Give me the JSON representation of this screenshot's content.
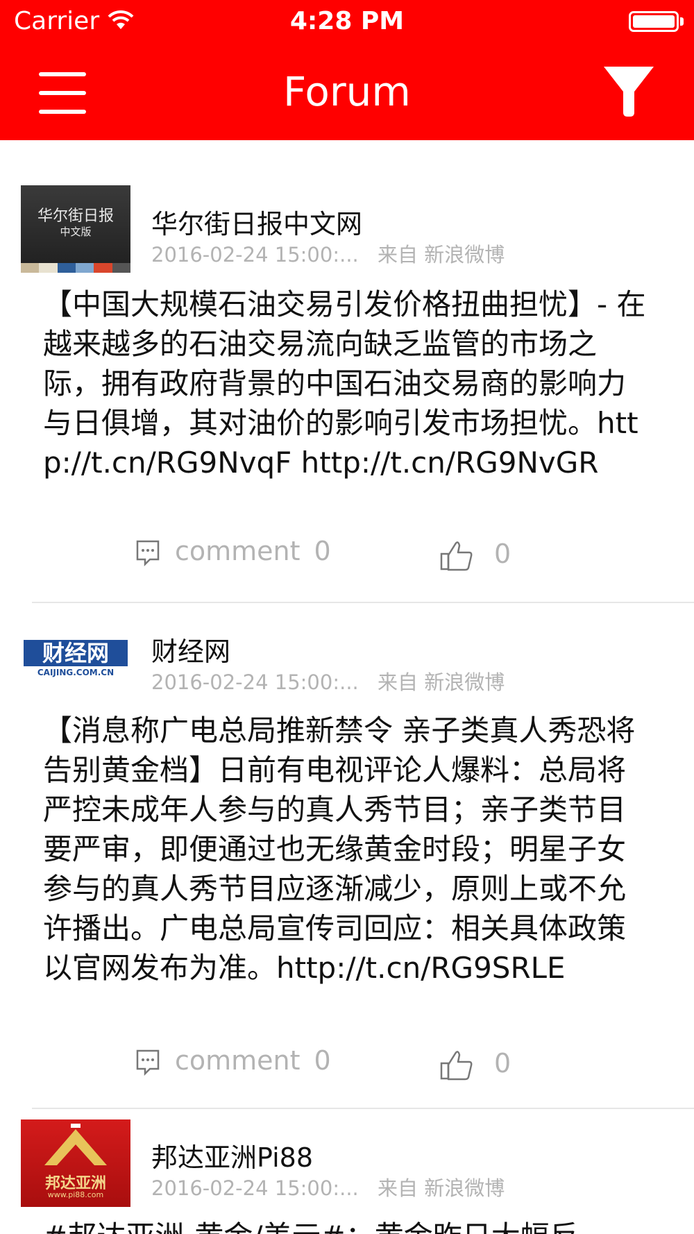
{
  "colors": {
    "brand": "#ff0000",
    "meta_text": "#b3b3b3"
  },
  "status_bar": {
    "carrier": "Carrier",
    "time": "4:28 PM"
  },
  "nav": {
    "title": "Forum",
    "menu_icon": "hamburger-menu-icon",
    "filter_icon": "filter-funnel-icon"
  },
  "posts": [
    {
      "avatar_text": "华尔街日报",
      "avatar_subtext": "中文版",
      "author": "华尔街日报中文网",
      "timestamp": "2016-02-24 15:00:...",
      "source": "来自 新浪微博",
      "body": "【中国大规模石油交易引发价格扭曲担忧】- 在越来越多的石油交易流向缺乏监管的市场之际，拥有政府背景的中国石油交易商的影响力与日俱增，其对油价的影响引发市场担忧。http://t.cn/RG9NvqF http://t.cn/RG9NvGR",
      "comment_label": "comment",
      "comment_count": "0",
      "like_count": "0"
    },
    {
      "avatar_text": "财经网",
      "avatar_subtext": "CAIJING.COM.CN",
      "author": "财经网",
      "timestamp": "2016-02-24 15:00:...",
      "source": "来自 新浪微博",
      "body": "【消息称广电总局推新禁令 亲子类真人秀恐将告别黄金档】日前有电视评论人爆料：总局将严控未成年人参与的真人秀节目；亲子类节目要严审，即便通过也无缘黄金时段；明星子女参与的真人秀节目应逐渐减少，原则上或不允许播出。广电总局宣传司回应：相关具体政策以官网发布为准。http://t.cn/RG9SRLE",
      "comment_label": "comment",
      "comment_count": "0",
      "like_count": "0"
    },
    {
      "avatar_text": "邦达亚洲",
      "avatar_subtext": "www.pi88.com",
      "author": "邦达亚洲Pi88",
      "timestamp": "2016-02-24 15:00:...",
      "source": "来自 新浪微博",
      "body": "#邦达亚洲-黄金/美元#：黄金昨日大幅反"
    }
  ]
}
